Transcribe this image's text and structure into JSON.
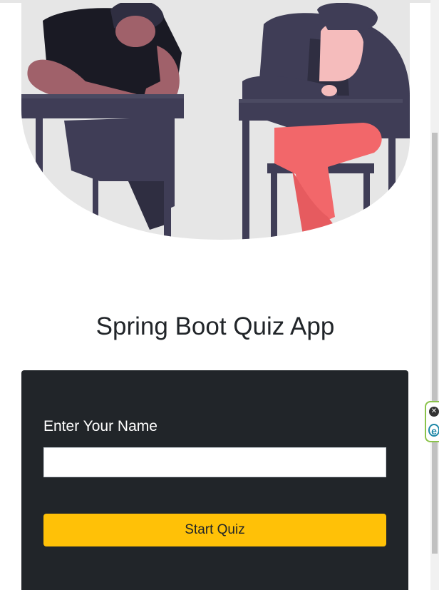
{
  "app": {
    "title": "Spring Boot Quiz App"
  },
  "form": {
    "name_label": "Enter Your Name",
    "name_value": "",
    "name_placeholder": "",
    "start_button": "Start Quiz"
  },
  "hero": {
    "icon": "students-taking-exam-illustration"
  },
  "extension": {
    "close_glyph": "✕",
    "logo_glyph": "e"
  },
  "colors": {
    "card_background": "#212529",
    "button_accent": "#ffc107",
    "title_text": "#212529"
  }
}
